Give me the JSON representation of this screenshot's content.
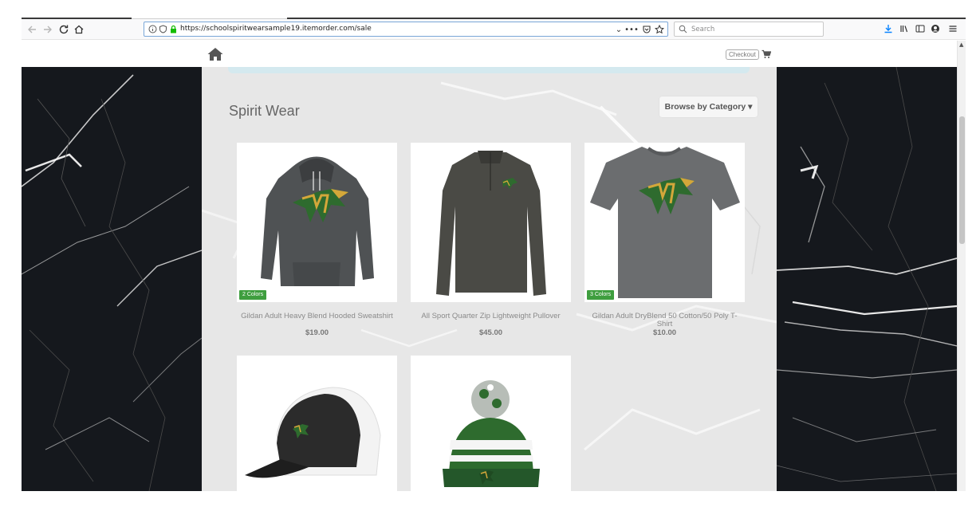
{
  "browser": {
    "url": "https://schoolspiritwearsample19.itemorder.com/sale",
    "search_placeholder": "Search",
    "icons": [
      "back-icon",
      "forward-icon",
      "reload-icon",
      "home-icon",
      "info-icon",
      "tracking-shield-icon",
      "lock-icon",
      "dropdown-icon",
      "more-icon",
      "pocket-icon",
      "bookmark-star-icon",
      "search-icon",
      "download-icon",
      "library-icon",
      "sidebar-icon",
      "account-icon",
      "menu-icon"
    ]
  },
  "site": {
    "checkout_label": "Checkout",
    "section_title": "Spirit Wear",
    "browse_label": "Browse by Category ▾",
    "accent_green": "#3e9e3e",
    "banner_color": "#d4e9ef"
  },
  "products": [
    {
      "name": "Gildan Adult Heavy Blend Hooded Sweatshirt",
      "price": "$19.00",
      "badge": "2 Colors",
      "icon": "hoodie-image"
    },
    {
      "name": "All Sport Quarter Zip Lightweight Pullover",
      "price": "$45.00",
      "badge": "",
      "icon": "pullover-image"
    },
    {
      "name": "Gildan Adult DryBlend 50 Cotton/50 Poly T-Shirt",
      "price": "$10.00",
      "badge": "3 Colors",
      "icon": "tshirt-image"
    },
    {
      "name": "",
      "price": "",
      "badge": "",
      "icon": "cap-image"
    },
    {
      "name": "",
      "price": "",
      "badge": "",
      "icon": "beanie-image"
    }
  ]
}
